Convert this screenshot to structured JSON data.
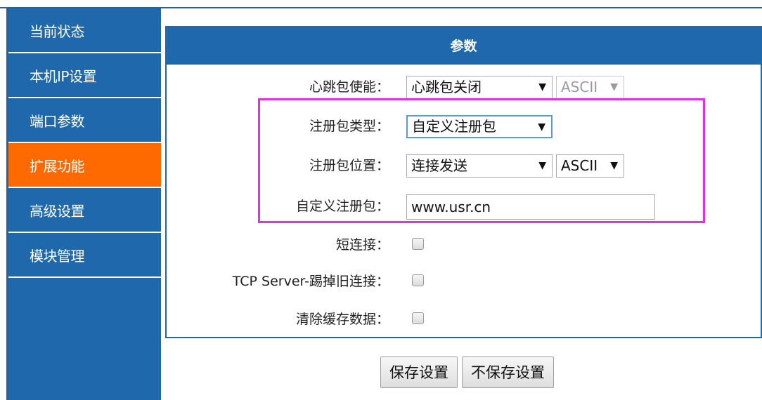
{
  "sidebar": {
    "items": [
      {
        "label": "当前状态"
      },
      {
        "label": "本机IP设置"
      },
      {
        "label": "端口参数"
      },
      {
        "label": "扩展功能"
      },
      {
        "label": "高级设置"
      },
      {
        "label": "模块管理"
      }
    ],
    "active_index": 3
  },
  "panel": {
    "title": "参数",
    "heartbeat": {
      "label": "心跳包使能：",
      "value": "心跳包关闭",
      "encoding": "ASCII"
    },
    "register_type": {
      "label": "注册包类型：",
      "value": "自定义注册包"
    },
    "register_position": {
      "label": "注册包位置：",
      "value": "连接发送",
      "encoding": "ASCII"
    },
    "custom_register": {
      "label": "自定义注册包：",
      "value": "www.usr.cn"
    },
    "short_connection": {
      "label": "短连接：",
      "checked": false
    },
    "tcp_kick_old": {
      "label": "TCP Server-踢掉旧连接：",
      "checked": false
    },
    "clear_cache": {
      "label": "清除缓存数据：",
      "checked": false
    }
  },
  "buttons": {
    "save": "保存设置",
    "discard": "不保存设置"
  },
  "colors": {
    "primary": "#1e68ab",
    "active": "#ff6a00",
    "highlight": "#e032e0"
  },
  "icons": {
    "dropdown": "▼"
  }
}
